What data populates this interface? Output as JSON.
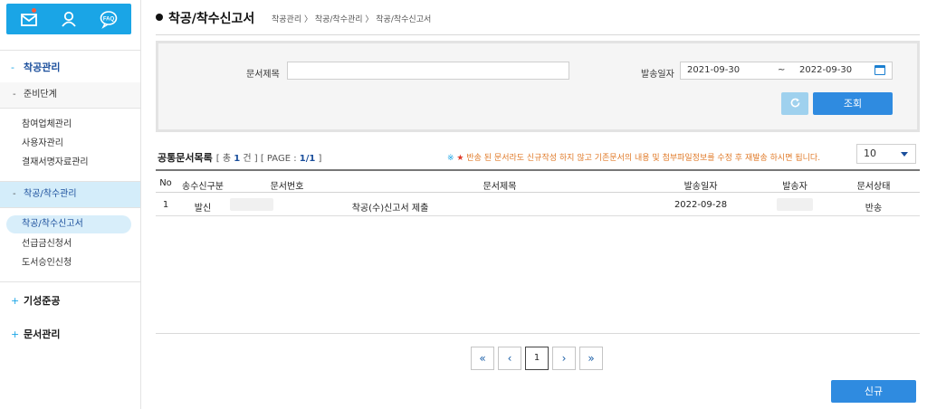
{
  "sidebar": {
    "top_icons": [
      "mail-icon",
      "user-icon",
      "faq-icon"
    ],
    "faq_label": "FAQ",
    "groups": [
      {
        "marker": "-",
        "label": "착공관리"
      },
      {
        "marker": "+",
        "label": "기성준공"
      },
      {
        "marker": "+",
        "label": "문서관리"
      }
    ],
    "sub_headers": [
      {
        "marker": "-",
        "label": "준비단계"
      },
      {
        "marker": "-",
        "label": "착공/착수관리"
      }
    ],
    "prep_items": [
      "참여업체관리",
      "사용자관리",
      "결재서명자료관리"
    ],
    "start_items": [
      "착공/착수신고서",
      "선급금신청서",
      "도서승인신청"
    ]
  },
  "header": {
    "title": "착공/착수신고서",
    "breadcrumb": "착공관리 〉 착공/착수관리 〉 착공/착수신고서"
  },
  "search": {
    "doc_title_label": "문서제목",
    "doc_title_value": "",
    "date_label": "발송일자",
    "date_from": "2021-09-30",
    "date_sep": "~",
    "date_to": "2022-09-30",
    "refresh_icon": "refresh-icon",
    "search_button": "조회"
  },
  "list": {
    "title": "공통문서목록",
    "count_prefix": "[ 총",
    "count": "1",
    "count_suffix": "건 ] [ PAGE :",
    "page": "1/1",
    "page_suffix": "]",
    "notice_mark1": "※",
    "notice_mark2": "★",
    "notice": "반송 된 문서라도 신규작성 하지 않고 기존문서의 내용 및 첨부파일정보를 수정 후 재발송 하시면 됩니다.",
    "page_size": "10",
    "columns": [
      "No",
      "송수신구분",
      "문서번호",
      "문서제목",
      "발송일자",
      "발송자",
      "문서상태"
    ],
    "rows": [
      {
        "no": "1",
        "direction": "발신",
        "doc_no": "",
        "doc_title": "착공(수)신고서 제출",
        "sent_date": "2022-09-28",
        "sender": "",
        "status": "반송"
      }
    ]
  },
  "pagination": {
    "first": "«",
    "prev": "‹",
    "current": "1",
    "next": "›",
    "last": "»"
  },
  "actions": {
    "new_button": "신규"
  },
  "colors": {
    "brand": "#1aa5e6",
    "primary_button": "#2f8be0",
    "refresh_button": "#9fd1ee",
    "active_nav": "#d4edfa",
    "notice": "#e07b2a"
  }
}
